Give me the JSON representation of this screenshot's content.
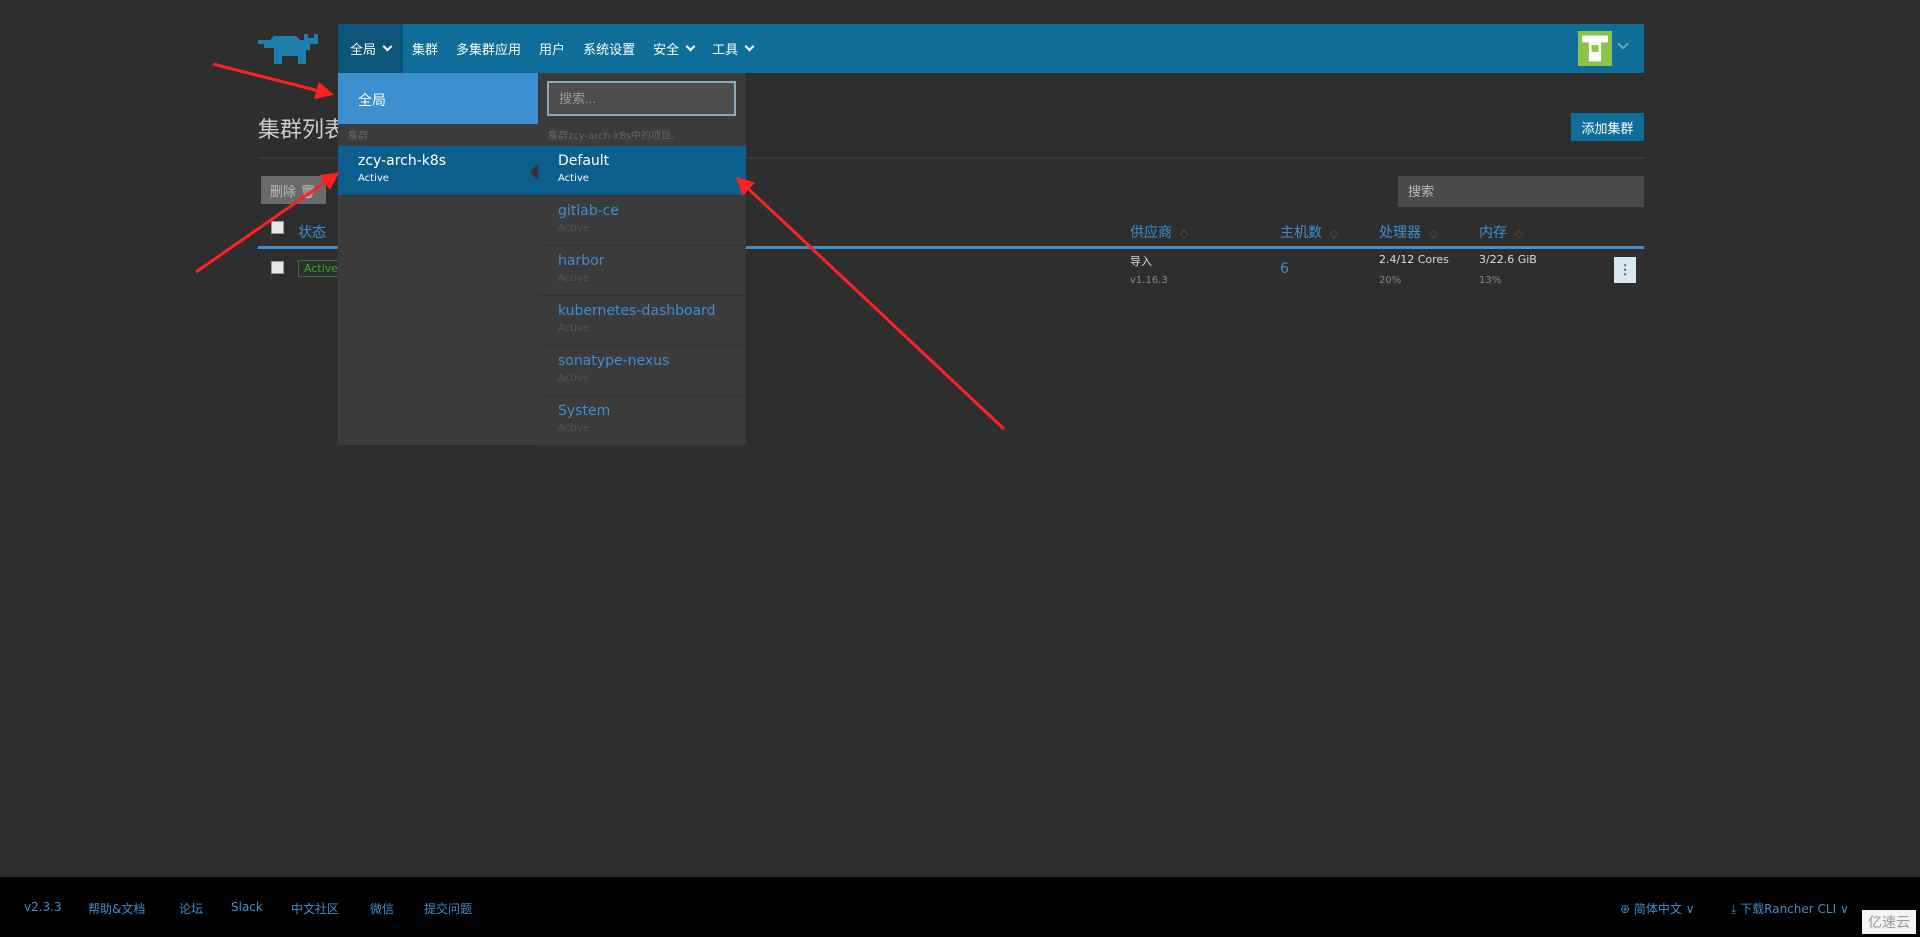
{
  "nav": {
    "items": [
      {
        "label": "全局",
        "dropdown": true
      },
      {
        "label": "集群"
      },
      {
        "label": "多集群应用"
      },
      {
        "label": "用户"
      },
      {
        "label": "系统设置"
      },
      {
        "label": "安全",
        "dropdown": true
      },
      {
        "label": "工具",
        "dropdown": true
      }
    ]
  },
  "page": {
    "title": "集群列表",
    "add_button": "添加集群",
    "delete_button": "删除",
    "search_placeholder": "搜索"
  },
  "table": {
    "headers": [
      "状态",
      "供应商",
      "主机数",
      "处理器",
      "内存"
    ],
    "rows": [
      {
        "state": "Active",
        "provider": "导入",
        "version": "v1.16.3",
        "hosts": "6",
        "cpu": "2.4/12 Cores",
        "cpu_pct": "20%",
        "mem": "3/22.6 GiB",
        "mem_pct": "13%"
      }
    ]
  },
  "dropdown": {
    "global": "全局",
    "cluster_caption": "集群",
    "cluster": {
      "name": "zcy-arch-k8s",
      "state": "Active"
    },
    "search_placeholder": "搜索...",
    "project_caption": "集群zcy-arch-k8s中的项目。",
    "projects": [
      {
        "name": "Default",
        "state": "Active"
      },
      {
        "name": "gitlab-ce",
        "state": "Active"
      },
      {
        "name": "harbor",
        "state": "Active"
      },
      {
        "name": "kubernetes-dashboard",
        "state": "Active"
      },
      {
        "name": "sonatype-nexus",
        "state": "Active"
      },
      {
        "name": "System",
        "state": "Active"
      }
    ]
  },
  "footer": {
    "links": [
      "v2.3.3",
      "帮助&文档",
      "论坛",
      "Slack",
      "中文社区",
      "微信",
      "提交问题"
    ],
    "language": "简体中文",
    "download": "下载Rancher CLI"
  },
  "watermark": "亿速云",
  "colors": {
    "accent": "#0f6e99",
    "highlight": "#3d8fcf",
    "annotation": "#ff2020"
  }
}
